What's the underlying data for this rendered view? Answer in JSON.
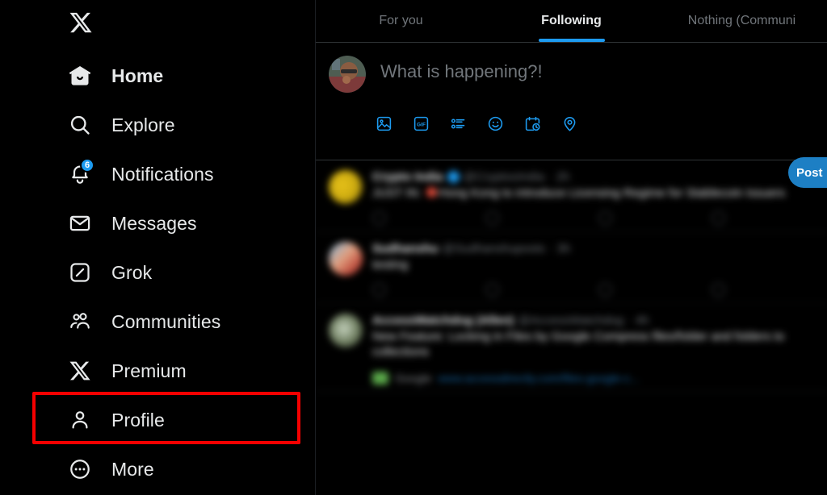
{
  "sidebar": {
    "brand_icon": "x-logo-icon",
    "items": [
      {
        "label": "Home",
        "icon": "home-icon",
        "active": true,
        "badge": null
      },
      {
        "label": "Explore",
        "icon": "search-icon",
        "active": false,
        "badge": null
      },
      {
        "label": "Notifications",
        "icon": "bell-icon",
        "active": false,
        "badge": "6"
      },
      {
        "label": "Messages",
        "icon": "envelope-icon",
        "active": false,
        "badge": null
      },
      {
        "label": "Grok",
        "icon": "grok-icon",
        "active": false,
        "badge": null
      },
      {
        "label": "Communities",
        "icon": "communities-icon",
        "active": false,
        "badge": null
      },
      {
        "label": "Premium",
        "icon": "x-logo-icon",
        "active": false,
        "badge": null
      },
      {
        "label": "Profile",
        "icon": "person-icon",
        "active": false,
        "badge": null
      },
      {
        "label": "More",
        "icon": "more-dots-icon",
        "active": false,
        "badge": null
      }
    ],
    "highlight": {
      "target_label": "Profile",
      "color": "#f50000"
    }
  },
  "tabs": [
    {
      "label": "For you",
      "active": false
    },
    {
      "label": "Following",
      "active": true
    },
    {
      "label": "Nothing (Communi",
      "active": false
    }
  ],
  "compose": {
    "placeholder": "What is happening?!",
    "avatar": "user-avatar",
    "post_label": "Post",
    "tools": [
      {
        "name": "media-image-icon"
      },
      {
        "name": "gif-icon"
      },
      {
        "name": "poll-icon"
      },
      {
        "name": "emoji-icon"
      },
      {
        "name": "schedule-icon"
      },
      {
        "name": "location-icon"
      }
    ],
    "accent_color": "#1d9bf0"
  },
  "feed": {
    "posts": [
      {
        "name": "Crypto India",
        "verified": true,
        "handle": "@CryptooIndia",
        "separator": "·",
        "time": "2h",
        "text_prefix": "JUST IN: ",
        "text": "Hong Kong to introduce Licensing Regime for Stablecoin Issuers",
        "avatar_style": "yellow",
        "link": null,
        "source": null,
        "actions": [
          "",
          "",
          "",
          ""
        ]
      },
      {
        "name": "Sudhanshu",
        "verified": false,
        "handle": "@Sudhanshuposts",
        "separator": "·",
        "time": "3h",
        "text_prefix": "",
        "text": "testing",
        "avatar_style": "multi",
        "link": null,
        "source": null,
        "actions": [
          "",
          "",
          "",
          ""
        ]
      },
      {
        "name": "AccessWatchdog (Allen)",
        "verified": false,
        "handle": "@AccessWatchdog",
        "separator": "·",
        "time": "4h",
        "text_prefix": "",
        "text": "New Feature: Locking in Files by Google Compress files/folder and folders to collections",
        "avatar_style": "green",
        "link": null,
        "source": {
          "badge": "green-app-icon",
          "name": "Google",
          "url": "www.accessdirectly.com/files-google-c..."
        },
        "actions": [
          "",
          "",
          "",
          ""
        ]
      }
    ]
  }
}
